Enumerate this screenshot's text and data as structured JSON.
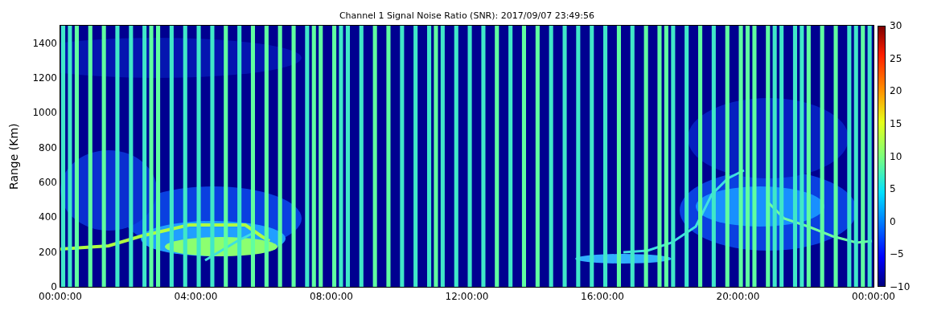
{
  "title": "Channel 1 Signal Noise Ratio (SNR): 2017/09/07 23:49:56",
  "y_axis": {
    "label": "Range (Km)",
    "ticks": [
      "1400",
      "1200",
      "1000",
      "800",
      "600",
      "400",
      "200",
      "0"
    ]
  },
  "x_axis": {
    "ticks": [
      "00:00:00",
      "04:00:00",
      "08:00:00",
      "12:00:00",
      "16:00:00",
      "20:00:00",
      "00:00:00"
    ]
  },
  "colorbar": {
    "ticks": [
      "30",
      "25",
      "20",
      "15",
      "10",
      "5",
      "0",
      "−5",
      "−10"
    ]
  }
}
